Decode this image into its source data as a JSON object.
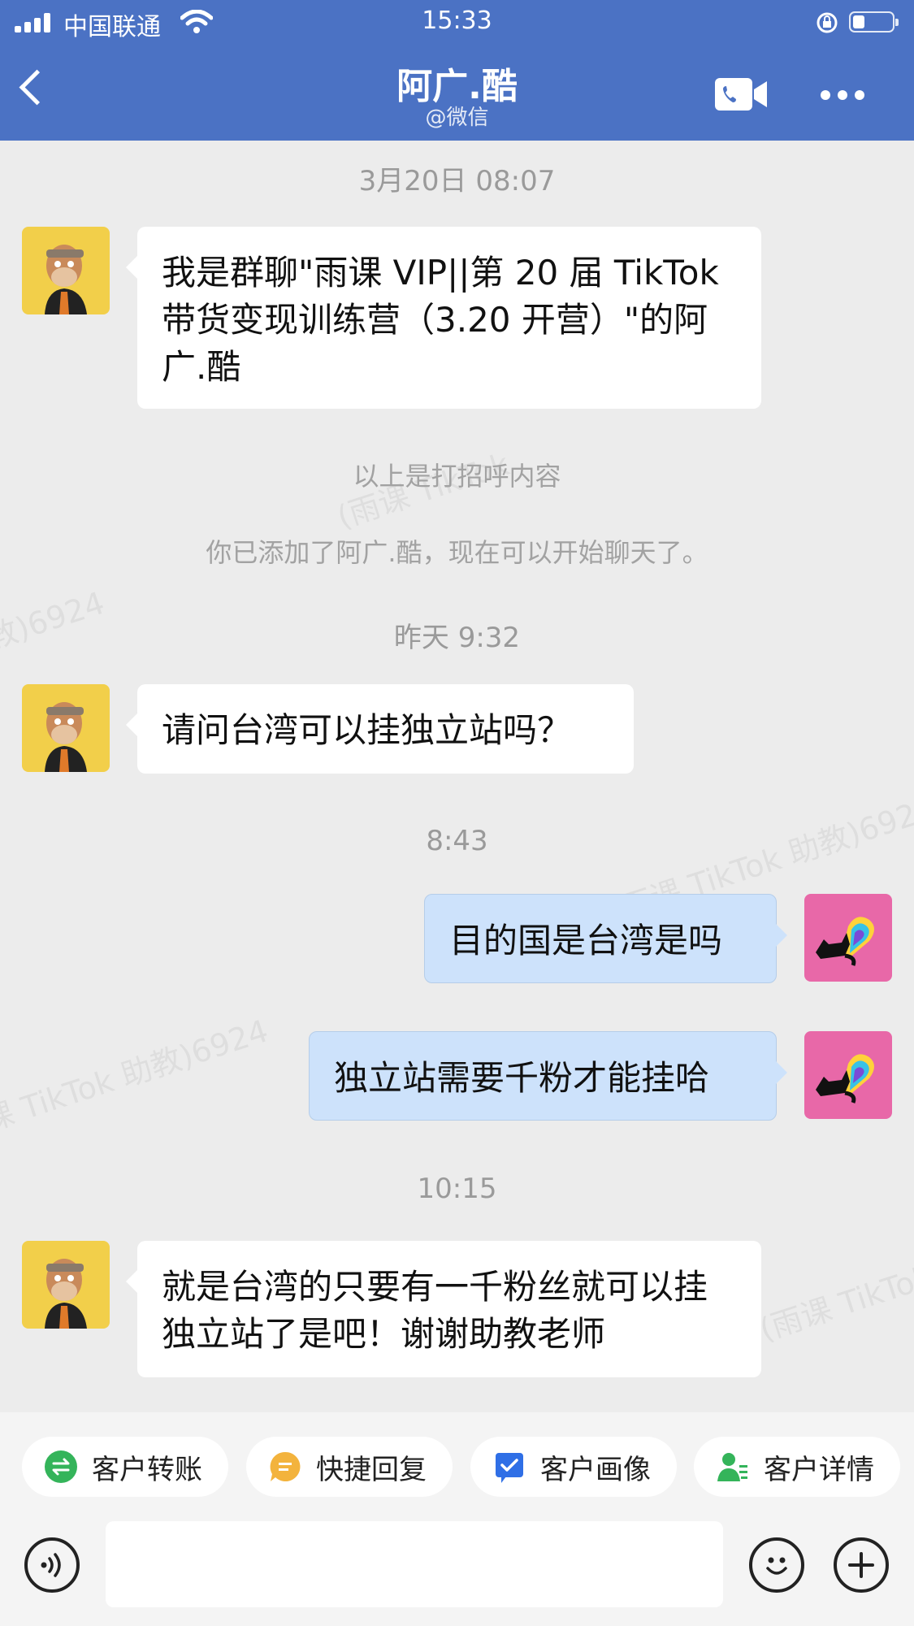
{
  "status_bar": {
    "carrier": "中国联通",
    "time": "15:33"
  },
  "nav": {
    "title": "阿广.酷",
    "subtitle": "@微信",
    "back_icon": "chevron-left-icon",
    "video_icon": "video-call-icon",
    "more_icon": "more-icon"
  },
  "chat": {
    "timestamps": [
      "3月20日 08:07",
      "昨天 9:32",
      "8:43",
      "10:15"
    ],
    "system_notes": [
      "以上是打招呼内容",
      "你已添加了阿广.酷，现在可以开始聊天了。"
    ],
    "messages": [
      {
        "side": "in",
        "text": "我是群聊\"雨课 VIP||第 20 届 TikTok 带货变现训练营（3.20 开营）\"的阿广.酷"
      },
      {
        "side": "in",
        "text": "请问台湾可以挂独立站吗？"
      },
      {
        "side": "out",
        "text": "目的国是台湾是吗"
      },
      {
        "side": "out",
        "text": "独立站需要千粉才能挂哈"
      },
      {
        "side": "in",
        "text": "就是台湾的只要有一千粉丝就可以挂独立站了是吧！谢谢助教老师"
      }
    ],
    "watermarks": [
      "雨课助教 (雨课 TikTok 助教)6924",
      "课 TikTok 助教)6924",
      "教)6924",
      "(雨课 TikTok"
    ]
  },
  "quick_actions": [
    {
      "label": "客户转账",
      "icon": "transfer-icon",
      "color": "#34b45a"
    },
    {
      "label": "快捷回复",
      "icon": "quick-reply-icon",
      "color": "#f3b33d"
    },
    {
      "label": "客户画像",
      "icon": "profile-check-icon",
      "color": "#2f6fe6"
    },
    {
      "label": "客户详情",
      "icon": "customer-detail-icon",
      "color": "#34b45a"
    }
  ],
  "input_bar": {
    "voice_icon": "voice-icon",
    "emoji_icon": "emoji-icon",
    "plus_icon": "plus-icon"
  },
  "colors": {
    "nav_bg": "#4b72c4",
    "chat_bg": "#ececec",
    "outgoing_bubble": "#cde2fb",
    "incoming_bubble": "#ffffff"
  }
}
